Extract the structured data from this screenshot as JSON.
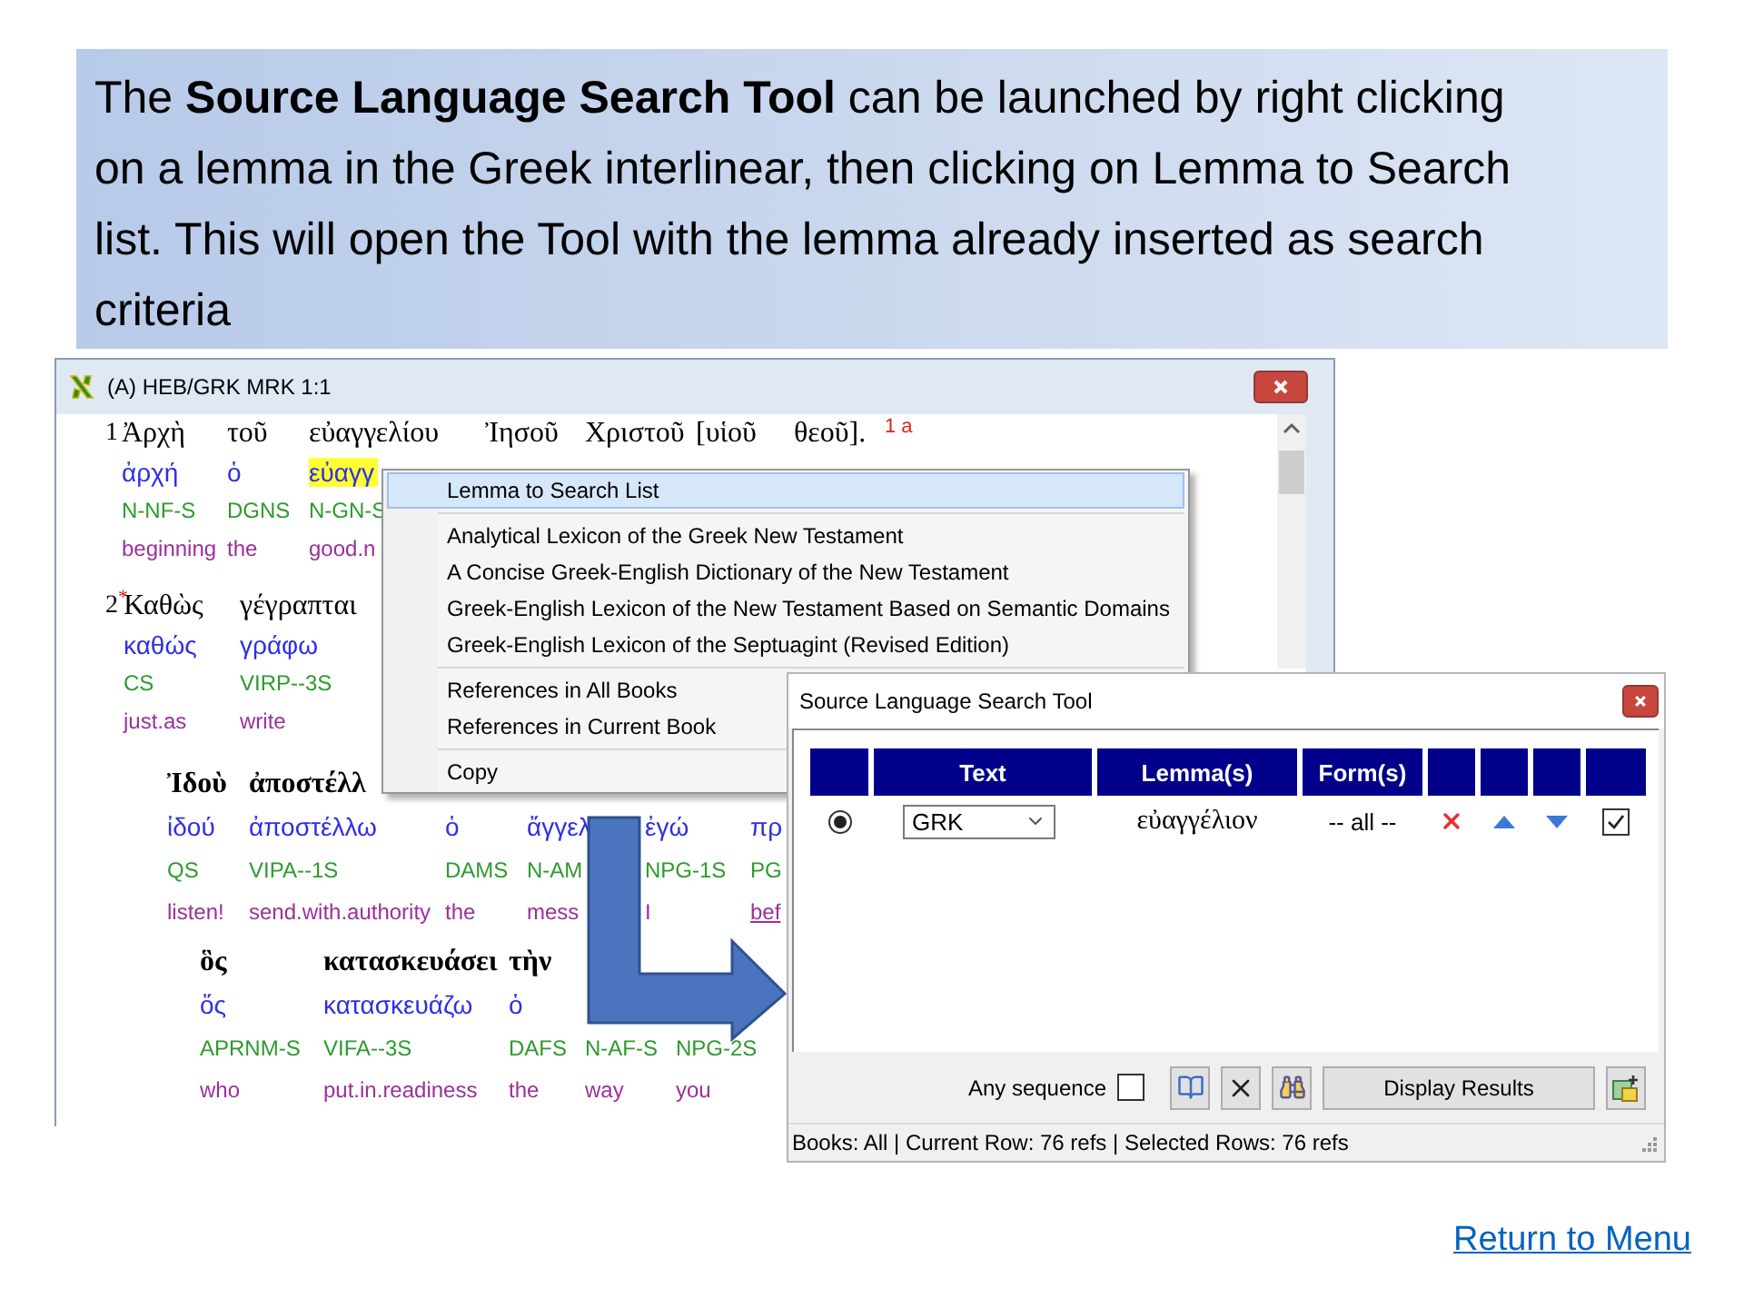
{
  "caption": "The **Source Language Search Tool** can be launched by right clicking on a lemma in the Greek interlinear, then clicking on Lemma to Search list. This will open the Tool with the lemma already inserted as search criteria",
  "interlinear_window": {
    "title": "(A) HEB/GRK MRK 1:1",
    "lines": [
      {
        "number": "1",
        "bold": false,
        "note": "1 a",
        "words": [
          {
            "greek": "Ἀρχὴ",
            "lemma": "ἀρχή",
            "parsing": "N-NF-S",
            "gloss": "beginning",
            "highlighted": false,
            "link": false
          },
          {
            "greek": "τοῦ",
            "lemma": "ὁ",
            "parsing": "DGNS",
            "gloss": "the",
            "highlighted": false,
            "link": false
          },
          {
            "greek": "εὐαγγελίου",
            "lemma": "εὐαγγ",
            "parsing": "N-GN-S",
            "gloss": "good.n",
            "highlighted": true,
            "link": false
          },
          {
            "greek": "Ἰησοῦ"
          },
          {
            "greek": "Χριστοῦ"
          },
          {
            "greek": "[υἱοῦ"
          },
          {
            "greek": "θεοῦ]."
          }
        ]
      },
      {
        "number": "2",
        "marker": "*",
        "bold": false,
        "words": [
          {
            "greek": "Καθὼς",
            "lemma": "καθώς",
            "parsing": "CS",
            "gloss": "just.as",
            "highlighted": false,
            "link": false
          },
          {
            "greek": "γέγραπται",
            "lemma": "γράφω",
            "parsing": "VIRP--3S",
            "gloss": "write",
            "highlighted": false,
            "link": false
          }
        ]
      },
      {
        "bold": true,
        "words": [
          {
            "greek": "Ἰδοὺ",
            "lemma": "ἰδού",
            "parsing": "QS",
            "gloss": "listen!",
            "highlighted": false,
            "link": false
          },
          {
            "greek": "ἀποστέλλ",
            "lemma": "ἀποστέλλω",
            "parsing": "VIPA--1S",
            "gloss": "send.with.authority",
            "highlighted": false,
            "link": false
          },
          {
            "lemma": "ὁ",
            "parsing": "DAMS",
            "gloss": "the",
            "highlighted": false,
            "link": false
          },
          {
            "lemma": "ἄγγελ",
            "parsing": "N-AM",
            "gloss": "mess",
            "highlighted": false,
            "link": false
          },
          {
            "lemma": "ἐγώ",
            "parsing": "NPG-1S",
            "gloss": "I",
            "highlighted": false,
            "link": false
          },
          {
            "lemma": "πρ",
            "parsing": "PG",
            "gloss": "bef",
            "highlighted": false,
            "link": true
          }
        ]
      },
      {
        "bold": true,
        "words": [
          {
            "greek": "ὃς",
            "lemma": "ὅς",
            "parsing": "APRNM-S",
            "gloss": "who",
            "highlighted": false,
            "link": false
          },
          {
            "greek": "κατασκευάσει",
            "lemma": "κατασκευάζω",
            "parsing": "VIFA--3S",
            "gloss": "put.in.readiness",
            "highlighted": false,
            "link": false
          },
          {
            "greek": "τὴν",
            "lemma": "ὁ",
            "parsing": "DAFS",
            "gloss": "the",
            "highlighted": false,
            "link": false
          },
          {
            "parsing": "N-AF-S",
            "gloss": "way",
            "link": false
          },
          {
            "parsing": "NPG-2S",
            "gloss": "you",
            "link": false
          }
        ]
      }
    ]
  },
  "context_menu": {
    "groups": [
      [
        {
          "label": "Lemma to Search List",
          "selected": true
        }
      ],
      [
        {
          "label": "Analytical Lexicon of the Greek New Testament",
          "selected": false
        },
        {
          "label": "A Concise Greek-English Dictionary of the New Testament",
          "selected": false
        },
        {
          "label": "Greek-English Lexicon of the New Testament Based on Semantic Domains",
          "selected": false
        },
        {
          "label": "Greek-English Lexicon of the Septuagint (Revised Edition)",
          "selected": false
        }
      ],
      [
        {
          "label": "References in All Books",
          "selected": false
        },
        {
          "label": "References in Current Book",
          "selected": false
        }
      ],
      [
        {
          "label": "Copy",
          "selected": false
        }
      ]
    ]
  },
  "search_tool": {
    "title": "Source Language Search Tool",
    "columns": [
      "Text",
      "Lemma(s)",
      "Form(s)"
    ],
    "rows": [
      {
        "selected": true,
        "text": "GRK",
        "lemma": "εὐαγγέλιον",
        "forms": "-- all --",
        "checked": true
      }
    ],
    "any_sequence": {
      "label": "Any sequence",
      "checked": false
    },
    "display_button": "Display Results",
    "status": "Books: All | Current Row: 76 refs | Selected Rows: 76 refs"
  },
  "return_link": "Return to Menu"
}
